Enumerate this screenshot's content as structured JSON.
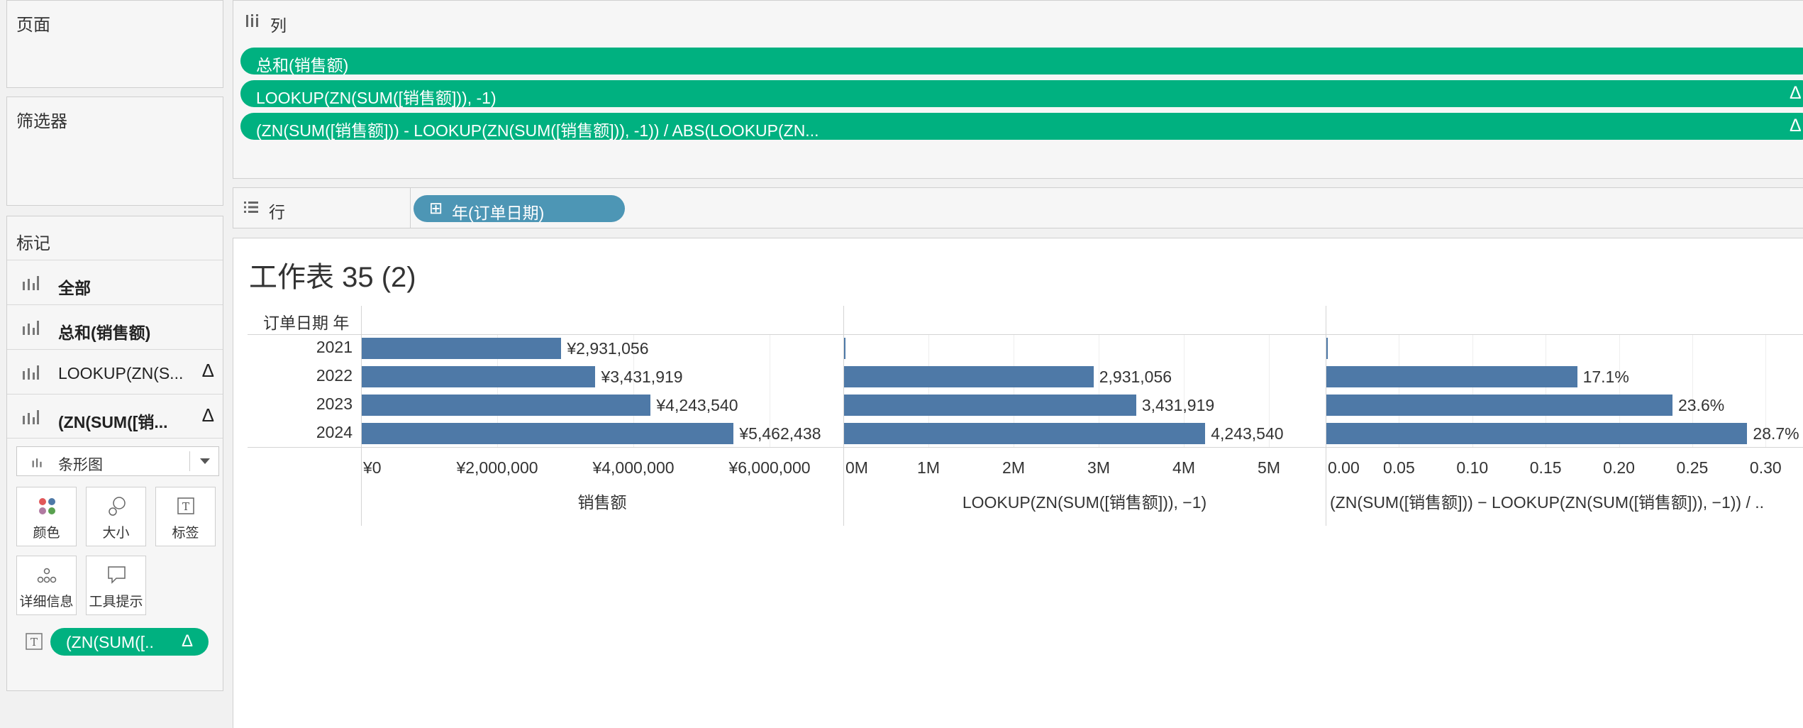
{
  "left_panels": {
    "pages_title": "页面",
    "filters_title": "筛选器",
    "marks_title": "标记"
  },
  "marks": {
    "items": [
      {
        "label": "全部",
        "delta": ""
      },
      {
        "label": "总和(销售额)",
        "delta": ""
      },
      {
        "label": "LOOKUP(ZN(S...",
        "delta": "Δ"
      },
      {
        "label": "(ZN(SUM([销...",
        "delta": "Δ"
      }
    ],
    "mark_type": "条形图",
    "buttons": [
      {
        "label": "颜色",
        "icon": "color-icon"
      },
      {
        "label": "大小",
        "icon": "size-icon"
      },
      {
        "label": "标签",
        "icon": "label-icon"
      },
      {
        "label": "详细信息",
        "icon": "detail-icon"
      },
      {
        "label": "工具提示",
        "icon": "tooltip-icon"
      }
    ],
    "label_pill": {
      "text": "(ZN(SUM([..",
      "delta": "Δ"
    }
  },
  "columns_shelf": {
    "title": "列",
    "pills": [
      {
        "text": "总和(销售额)",
        "delta": ""
      },
      {
        "text": "LOOKUP(ZN(SUM([销售额])), -1)",
        "delta": "Δ"
      },
      {
        "text": "(ZN(SUM([销售额])) - LOOKUP(ZN(SUM([销售额])), -1)) / ABS(LOOKUP(ZN...",
        "delta": "Δ"
      }
    ]
  },
  "rows_shelf": {
    "title": "行",
    "pill": "年(订单日期)",
    "pill_icon": "⊞"
  },
  "view": {
    "title": "工作表 35 (2)",
    "row_header": "订单日期 年",
    "years": [
      "2021",
      "2022",
      "2023",
      "2024"
    ]
  },
  "colors": {
    "green_pill": "#00b180",
    "blue_pill": "#4d96b5",
    "bar": "#4e79a7"
  },
  "chart_data": [
    {
      "type": "bar",
      "orientation": "horizontal",
      "categories": [
        "2021",
        "2022",
        "2023",
        "2024"
      ],
      "values": [
        2931056,
        3431919,
        4243540,
        5462438
      ],
      "data_labels": [
        "¥2,931,056",
        "¥3,431,919",
        "¥4,243,540",
        "¥5,462,438"
      ],
      "xlabel": "销售额",
      "ticks": [
        "¥0",
        "¥2,000,000",
        "¥4,000,000",
        "¥6,000,000"
      ],
      "tick_values": [
        0,
        2000000,
        4000000,
        6000000
      ],
      "xlim": [
        0,
        7000000
      ]
    },
    {
      "type": "bar",
      "orientation": "horizontal",
      "categories": [
        "2021",
        "2022",
        "2023",
        "2024"
      ],
      "values": [
        0,
        2931056,
        3431919,
        4243540
      ],
      "data_labels": [
        "",
        "2,931,056",
        "3,431,919",
        "4,243,540"
      ],
      "xlabel": "LOOKUP(ZN(SUM([销售额])), −1)",
      "ticks": [
        "0M",
        "1M",
        "2M",
        "3M",
        "4M",
        "5M"
      ],
      "tick_values": [
        0,
        1000000,
        2000000,
        3000000,
        4000000,
        5000000
      ],
      "xlim": [
        0,
        5600000
      ]
    },
    {
      "type": "bar",
      "orientation": "horizontal",
      "categories": [
        "2021",
        "2022",
        "2023",
        "2024"
      ],
      "values": [
        0,
        0.171,
        0.236,
        0.287
      ],
      "data_labels": [
        "",
        "17.1%",
        "23.6%",
        "28.7%"
      ],
      "xlabel": "(ZN(SUM([销售额])) − LOOKUP(ZN(SUM([销售额])), −1)) / ..",
      "ticks": [
        "0.00",
        "0.05",
        "0.10",
        "0.15",
        "0.20",
        "0.25",
        "0.30"
      ],
      "tick_values": [
        0,
        0.05,
        0.1,
        0.15,
        0.2,
        0.25,
        0.3
      ],
      "xlim": [
        0,
        0.325
      ]
    }
  ]
}
